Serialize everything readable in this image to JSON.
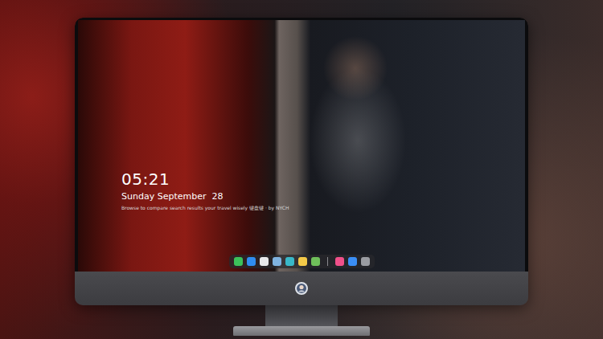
{
  "monitor": {
    "screen": {
      "wallpaper": {
        "kind": "photo"
      },
      "clock": {
        "time": "05:21",
        "date": "Sunday September  28",
        "caption": "Browse to compare search results your travel wisely 键盘键 · by NYCH"
      },
      "dock": {
        "items": [
          {
            "kind": "app",
            "color": "#3cc15a"
          },
          {
            "kind": "app",
            "color": "#2f8df0"
          },
          {
            "kind": "app",
            "color": "#e8e8ea"
          },
          {
            "kind": "app",
            "color": "#7fb3e0"
          },
          {
            "kind": "app",
            "color": "#39b8c8"
          },
          {
            "kind": "app",
            "color": "#f3c948"
          },
          {
            "kind": "app",
            "color": "#6fbf5a"
          },
          {
            "kind": "separator",
            "color": "#8a8a8e"
          },
          {
            "kind": "app",
            "color": "#f0508a"
          },
          {
            "kind": "app",
            "color": "#3a8ef5"
          },
          {
            "kind": "app",
            "color": "#9a9ca2"
          }
        ]
      }
    }
  }
}
